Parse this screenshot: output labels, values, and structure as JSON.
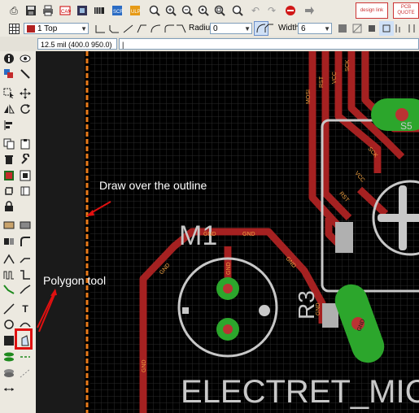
{
  "toolbar_top": {
    "icons": [
      "export-icon",
      "save-icon",
      "print-icon",
      "cam-icon",
      "brd-sch-switch-icon",
      "ulp-icon",
      "script-icon",
      "script-run-icon",
      "zoom-fit-icon",
      "zoom-in-icon",
      "zoom-out-icon",
      "zoom-redraw-icon",
      "zoom-select-icon",
      "undo-icon",
      "redo-icon",
      "stop-icon",
      "go-icon",
      "designlink-icon",
      "pcb-quote-icon"
    ],
    "designlink_label": "design link",
    "pcb_quote_label": "PCB QUOTE"
  },
  "toolbar_params": {
    "layer_value": "1 Top",
    "layer_color": "#b22222",
    "radius_label": "Radius:",
    "radius_value": "0",
    "width_label": "Width:",
    "width_value": "6"
  },
  "coord_bar": {
    "readout": "12.5 mil (400.0 950.0)",
    "command_value": "|"
  },
  "left_toolbar": {
    "tools": [
      "info-icon",
      "show-icon",
      "display-layers-icon",
      "mark-icon",
      "move-icon",
      "copy-icon",
      "mirror-icon",
      "rotate-icon",
      "align-icon",
      "group-icon",
      "delete-icon",
      "change-icon",
      "add-icon",
      "paste-icon",
      "replace-icon",
      "lock-icon",
      "name-icon",
      "value-icon",
      "smash-icon",
      "miter-icon",
      "split-icon",
      "optimize-icon",
      "route-icon",
      "ripup-icon",
      "wire-icon",
      "text-icon",
      "circle-icon",
      "arc-icon",
      "rect-icon",
      "polygon-icon",
      "via-icon",
      "signal-icon",
      "hole-icon",
      "ratsnest-icon",
      "dimension-icon",
      "auto-icon",
      "erc-icon",
      "drc-icon",
      "errors-icon"
    ]
  },
  "canvas": {
    "callouts": {
      "outline": "Draw over the outline",
      "polygon": "Polygon tool"
    },
    "silkscreen": {
      "m1": "M1",
      "r3": "R3",
      "electret": "ELECTRET_MICR",
      "s5": "S5"
    },
    "net_labels": {
      "gnd": "GND",
      "mosi": "MOSI",
      "rst": "RST",
      "vcc": "VCC",
      "sck": "SCK"
    },
    "colors": {
      "board_bg": "#000000",
      "trace": "#a52121",
      "pad_green": "#2ca62c",
      "silk": "#c8c8c8",
      "outline": "#e87a1a",
      "grid": "#2a2a2a",
      "keepout": "#b0b0b0",
      "dark_panel": "#1a1a1a",
      "callout_red": "#e01010"
    }
  }
}
